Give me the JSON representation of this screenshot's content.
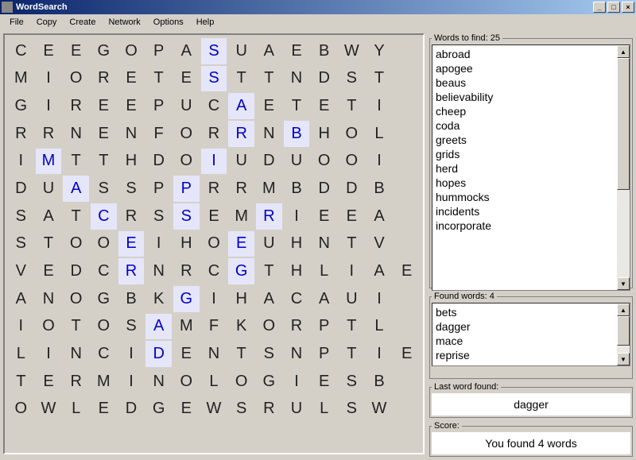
{
  "window": {
    "title": "WordSearch"
  },
  "menu": [
    "File",
    "Copy",
    "Create",
    "Network",
    "Options",
    "Help"
  ],
  "grid": {
    "rows": [
      "CEEGOPASUAEBWY ",
      "MIORETESTTNDST ",
      "GIREEPUCAETETI ",
      "RRNENFORRNBHOL ",
      "IMTTHDOIUDUOOI ",
      "DUASSPPRRMBDDB ",
      "SATCRSSEMRIEEA ",
      "STOOEIHOEUHNTV ",
      "VEDCRNRCGTHLIAE",
      "ANOGBKGIHACAUI ",
      "IOTOSAMFKORPTL ",
      "LINCIDENTSNPTIE",
      "TERMINOLOGIESB ",
      "OWLEDGEWSRULSW "
    ],
    "highlighted": [
      [
        0,
        7
      ],
      [
        1,
        7
      ],
      [
        2,
        8
      ],
      [
        3,
        8
      ],
      [
        3,
        10
      ],
      [
        4,
        1
      ],
      [
        4,
        7
      ],
      [
        5,
        2
      ],
      [
        5,
        6
      ],
      [
        6,
        3
      ],
      [
        6,
        6
      ],
      [
        6,
        9
      ],
      [
        7,
        4
      ],
      [
        7,
        8
      ],
      [
        8,
        4
      ],
      [
        8,
        8
      ],
      [
        9,
        6
      ],
      [
        10,
        5
      ],
      [
        11,
        5
      ]
    ]
  },
  "wordsToFind": {
    "legend": "Words to find:  25",
    "items": [
      "abroad",
      "apogee",
      "beaus",
      "believability",
      "cheep",
      "coda",
      "greets",
      "grids",
      "herd",
      "hopes",
      "hummocks",
      "incidents",
      "incorporate"
    ]
  },
  "foundWords": {
    "legend": "Found words:  4",
    "items": [
      "bets",
      "dagger",
      "mace",
      "reprise"
    ]
  },
  "lastWordFound": {
    "legend": "Last word found:",
    "value": "dagger"
  },
  "score": {
    "legend": "Score:",
    "value": "You found 4 words"
  }
}
